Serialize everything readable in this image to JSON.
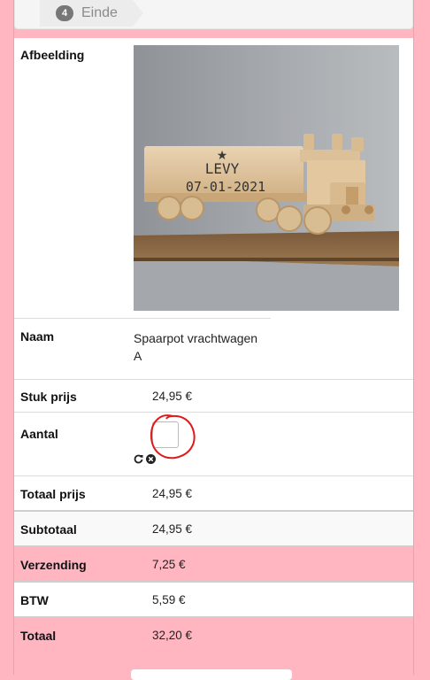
{
  "steps": {
    "number": "4",
    "label": "Einde"
  },
  "product": {
    "image_label": "Afbeelding",
    "engraving_name": "LEVY",
    "engraving_date": "07-01-2021",
    "name_label": "Naam",
    "name_value": "Spaarpot vrachtwagen A",
    "unit_price_label": "Stuk prijs",
    "unit_price_value": "24,95 €",
    "quantity_label": "Aantal",
    "quantity_value": "",
    "total_label": "Totaal prijs",
    "total_value": "24,95 €"
  },
  "summary": {
    "subtotal_label": "Subtotaal",
    "subtotal_value": "24,95 €",
    "shipping_label": "Verzending",
    "shipping_value": "7,25 €",
    "vat_label": "BTW",
    "vat_value": "5,59 €",
    "total_label": "Totaal",
    "total_value": "32,20 €"
  },
  "colors": {
    "page_bg": "#ffb6c1",
    "highlight_row": "#ffb6c1",
    "annotation": "#e01919"
  }
}
